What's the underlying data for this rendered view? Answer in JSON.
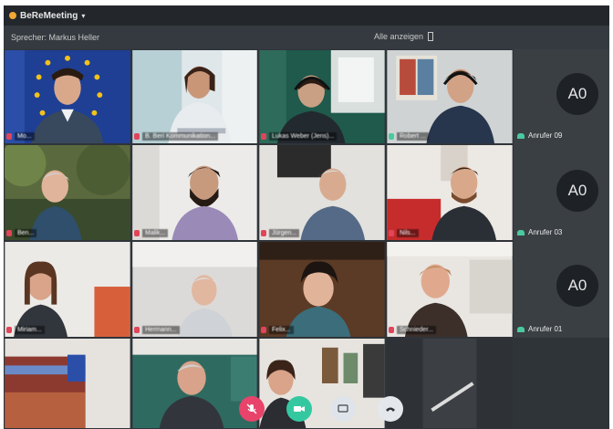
{
  "meeting": {
    "title": "BeReMeeting"
  },
  "subbar": {
    "speaker": "Sprecher: Markus Heller",
    "view_label": "Alle anzeigen"
  },
  "participants": [
    {
      "name": "Mo..."
    },
    {
      "name": "B. Beri Kommunikation..."
    },
    {
      "name": "Lukas Weber (Jens)..."
    },
    {
      "name": "Robert ..."
    },
    {
      "name": "Ben..."
    },
    {
      "name": "Malik..."
    },
    {
      "name": "Jürgen..."
    },
    {
      "name": "Nils..."
    },
    {
      "name": "Miriam..."
    },
    {
      "name": "Hermann..."
    },
    {
      "name": "Felix..."
    },
    {
      "name": "Schnieder..."
    }
  ],
  "anonymous": [
    {
      "initials": "A0",
      "name": "Anrufer 09"
    },
    {
      "initials": "A0",
      "name": "Anrufer 03"
    },
    {
      "initials": "A0",
      "name": "Anrufer 01"
    }
  ],
  "controls": [
    {
      "icon": "mic-off-icon",
      "color": "#e8436a"
    },
    {
      "icon": "video-icon",
      "color": "#34c8a1"
    },
    {
      "icon": "screen-share-icon",
      "color": "#dfe4ea"
    },
    {
      "icon": "hang-up-icon",
      "color": "#e4e8ec"
    }
  ],
  "colors": {
    "accent": "#f0a733",
    "mic_muted": "#e0455a",
    "phone": "#4bc99e"
  }
}
